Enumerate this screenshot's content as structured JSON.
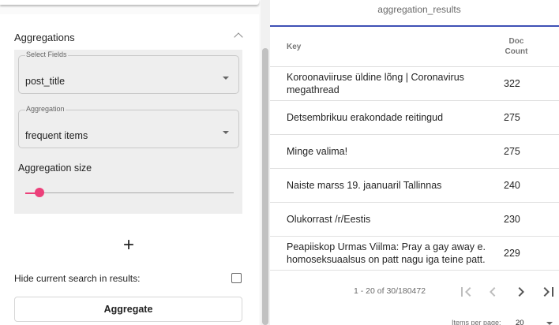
{
  "aggregations": {
    "header": "Aggregations",
    "select_fields": {
      "label": "Select Fields",
      "value": "post_title"
    },
    "aggregation": {
      "label": "Aggregation",
      "value": "frequent items"
    },
    "size_label": "Aggregation size",
    "slider_level": 0.07,
    "add_symbol": "+",
    "hide_label": "Hide current search in results:",
    "hide_checked": false,
    "aggregate_button": "Aggregate"
  },
  "results": {
    "title": "aggregation_results",
    "columns": {
      "key": "Key",
      "count_line1": "Doc",
      "count_line2": "Count"
    },
    "rows": [
      {
        "key": "Koroonaviiruse üldine lõng | Coronavirus megathread",
        "count": "322"
      },
      {
        "key": "Detsembrikuu erakondade reitingud",
        "count": "275"
      },
      {
        "key": "Minge valima!",
        "count": "275"
      },
      {
        "key": "Naiste marss 19. jaanuaril Tallinnas",
        "count": "240"
      },
      {
        "key": "Olukorrast /r/Eestis",
        "count": "230"
      },
      {
        "key": "Peapiiskop Urmas Viilma: Pray a gay away e. homoseksuaalsus on patt nagu iga teine patt.",
        "count": "229"
      }
    ],
    "paginator": {
      "range": "1 - 20 of 30/180472",
      "items_per_page_label": "Items per page:",
      "items_per_page_value": "20"
    }
  },
  "colors": {
    "accent": "#ec407a",
    "primary": "#3f51b5"
  }
}
